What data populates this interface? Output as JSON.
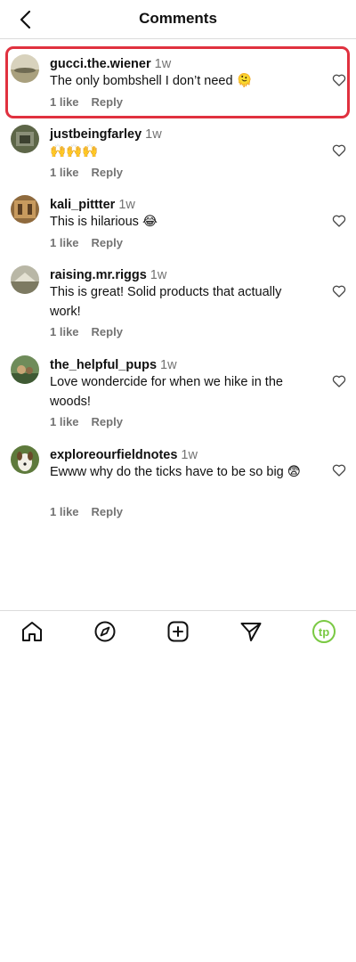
{
  "header": {
    "title": "Comments",
    "back_icon": "chevron-left-icon"
  },
  "comments": [
    {
      "username": "gucci.the.wiener",
      "time": "1w",
      "text": "The only bombshell I don’t need 🫠",
      "likes": "1 like",
      "reply": "Reply"
    },
    {
      "username": "justbeingfarley",
      "time": "1w",
      "text": "🙌🙌🙌",
      "likes": "1 like",
      "reply": "Reply"
    },
    {
      "username": "kali_pittter",
      "time": "1w",
      "text": "This is hilarious 😂",
      "likes": "1 like",
      "reply": "Reply"
    },
    {
      "username": "raising.mr.riggs",
      "time": "1w",
      "text": "This is great! Solid products that actually work!",
      "likes": "1 like",
      "reply": "Reply"
    },
    {
      "username": "the_helpful_pups",
      "time": "1w",
      "text": "Love wondercide for when we hike in the woods!",
      "likes": "1 like",
      "reply": "Reply"
    },
    {
      "username": "exploreourfieldnotes",
      "time": "1w",
      "text": "Ewww why do the ticks have to be so big 😨",
      "likes": "1 like",
      "reply": "Reply"
    }
  ],
  "bottom_nav": [
    "home-icon",
    "explore-compass-icon",
    "new-post-icon",
    "direct-send-icon",
    "profile-tp-icon"
  ],
  "profile_badge": "tp",
  "colors": {
    "highlight": "#e0313f",
    "secondary_text": "#737373",
    "profile_accent": "#7ac943"
  }
}
